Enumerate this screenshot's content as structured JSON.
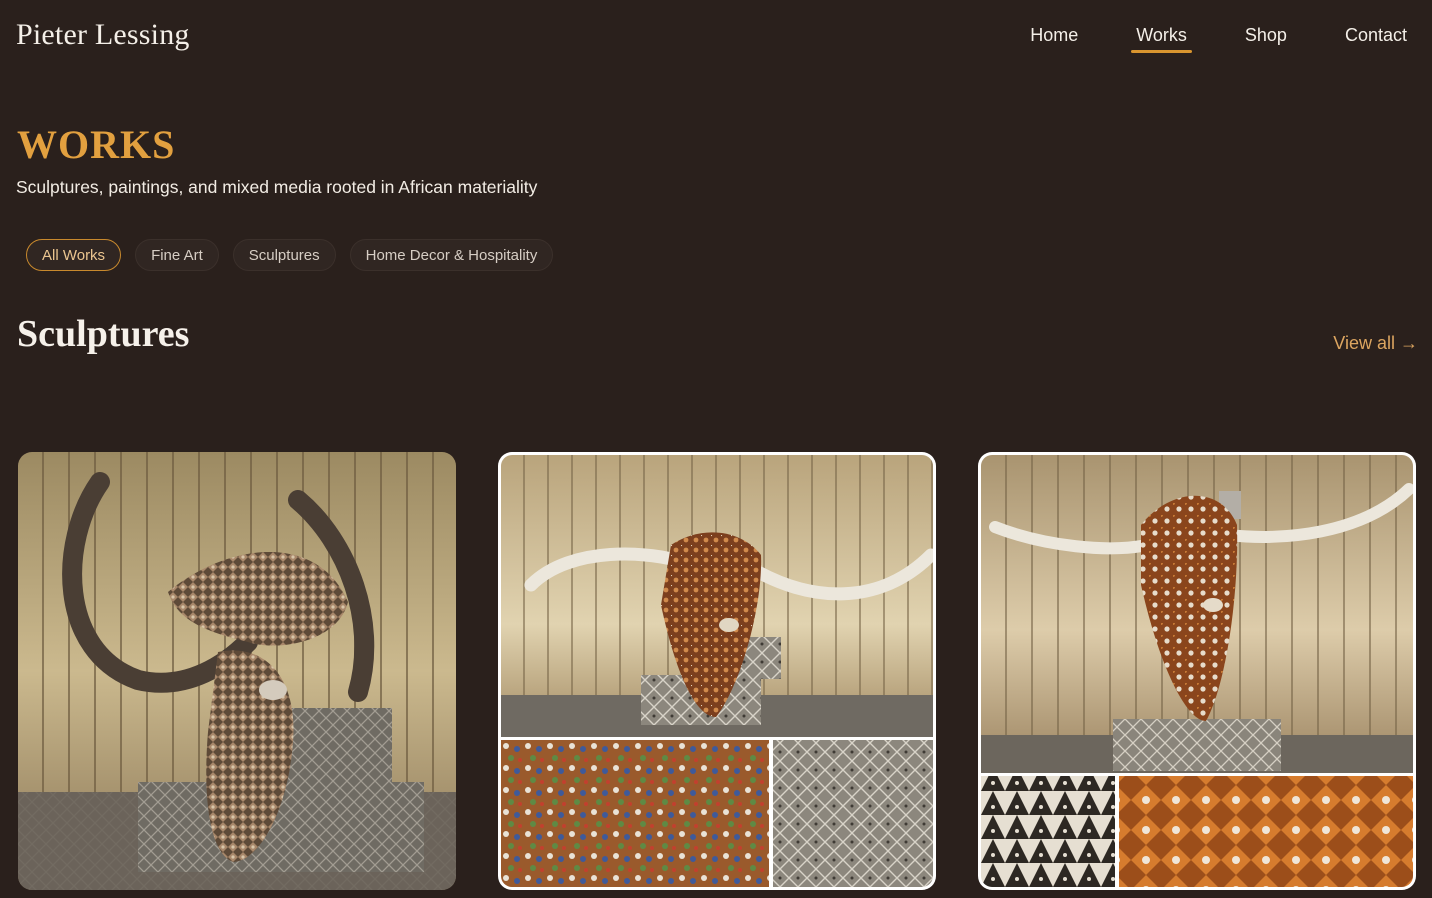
{
  "site": {
    "brand": "Pieter Lessing"
  },
  "nav": {
    "items": [
      "Home",
      "Works",
      "Shop",
      "Contact"
    ],
    "active": "Works"
  },
  "page": {
    "title": "WORKS",
    "subtitle": "Sculptures, paintings, and mixed media rooted in African materiality"
  },
  "filters": {
    "items": [
      "All Works",
      "Fine Art",
      "Sculptures",
      "Home Decor & Hospitality"
    ],
    "active": "All Works"
  },
  "section": {
    "title": "Sculptures",
    "view_all": "View all →"
  },
  "cards": [
    {
      "image": "beaded-buffalo-skull-sculpture"
    },
    {
      "image": "beaded-longhorn-skull-sculpture-with-detail-collage"
    },
    {
      "image": "beaded-longhorn-skull-on-plinth-with-detail-collage"
    }
  ],
  "colors": {
    "background": "#2a201c",
    "accent": "#d9952f",
    "text": "#f4efe8"
  }
}
